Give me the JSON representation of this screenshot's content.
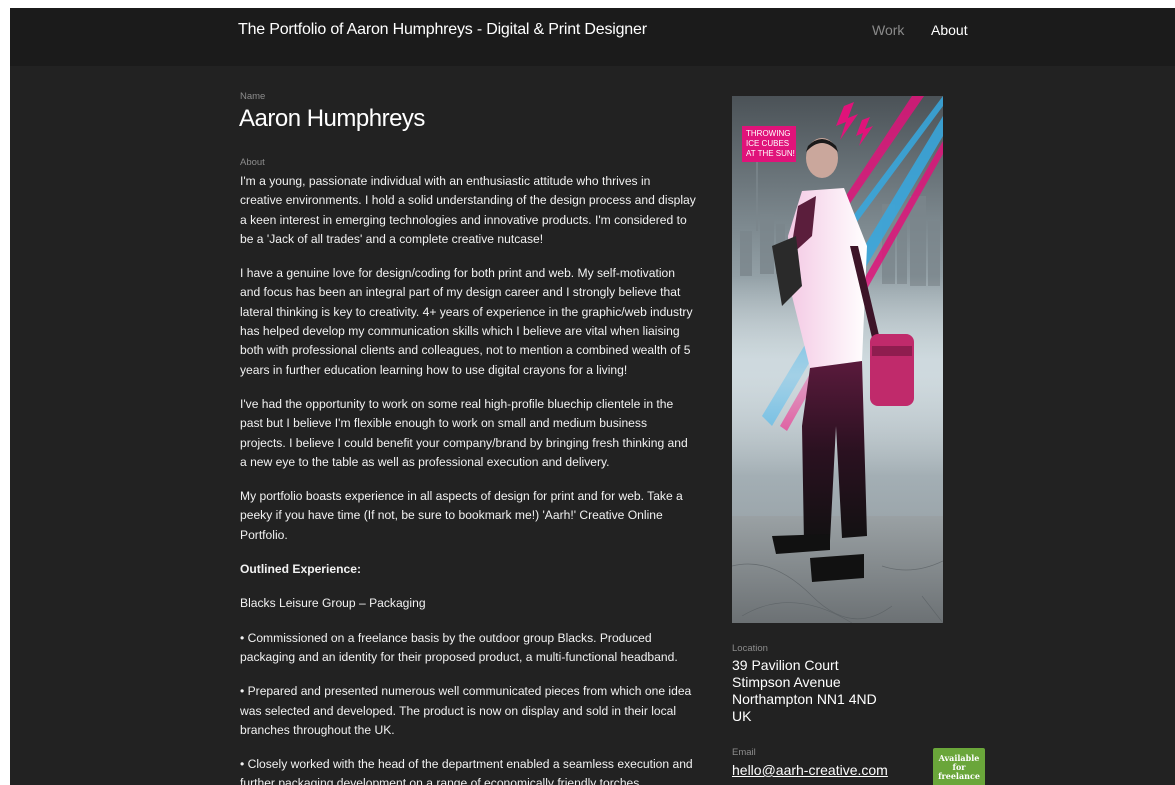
{
  "header": {
    "site_title": "The Portfolio of Aaron Humphreys - Digital & Print Designer",
    "nav": [
      {
        "label": "Work"
      },
      {
        "label": "About"
      }
    ]
  },
  "profile": {
    "name_label": "Name",
    "name": "Aaron Humphreys",
    "about_label": "About",
    "paragraphs": [
      "I'm a young, passionate individual with an enthusiastic attitude who thrives in creative environments. I hold a solid understanding of the design process and display a keen interest in emerging technologies and innovative products. I'm considered to be a 'Jack of all trades' and a complete creative nutcase!",
      "I have a genuine love for design/coding for both print and web. My self-motivation and focus has been an integral part of my design career and I strongly believe that lateral thinking is key to creativity. 4+ years of experience in the graphic/web industry has helped develop my communication skills which I believe are vital when liaising both with professional clients and colleagues, not to mention a combined wealth of 5 years in further education learning how to use digital crayons for a living!",
      "I've had the opportunity to work on some real high-profile bluechip clientele in the past but I believe I'm flexible enough to work on small and medium business projects. I believe I could benefit your company/brand by bringing fresh thinking and a new eye to the table as well as professional execution and delivery.",
      "My portfolio boasts experience in all aspects of design for print and for web. Take a peeky if you have time (If not, be sure to bookmark me!) 'Aarh!' Creative Online Portfolio."
    ],
    "experience_heading": "Outlined Experience:",
    "experience_items": [
      "Blacks Leisure Group – Packaging",
      "• Commissioned on a freelance basis by the outdoor group Blacks. Produced packaging and an identity for their proposed product, a multi-functional headband.",
      "• Prepared and presented numerous well communicated pieces from which one idea was selected and developed. The product is now on display and sold in their local branches throughout the UK.",
      "• Closely worked with the head of the department enabled a seamless execution and further packaging development on a range of economically friendly torches."
    ]
  },
  "photo": {
    "sign_text": [
      "THROWING",
      "ICE CUBES",
      "AT THE SUN!"
    ]
  },
  "location": {
    "label": "Location",
    "lines": [
      "39 Pavilion Court",
      "Stimpson Avenue",
      "Northampton NN1 4ND",
      "UK"
    ]
  },
  "email": {
    "label": "Email",
    "address": "hello@aarh-creative.com"
  },
  "badge": {
    "lines": [
      "Available",
      "for",
      "freelance"
    ]
  },
  "colors": {
    "background": "#222222",
    "header": "#1b1b1b",
    "text": "#f2f2f2",
    "muted": "#8c8c8c",
    "badge": "#6aa63a",
    "accent_pink": "#e0137a",
    "accent_blue": "#36a9e1"
  }
}
